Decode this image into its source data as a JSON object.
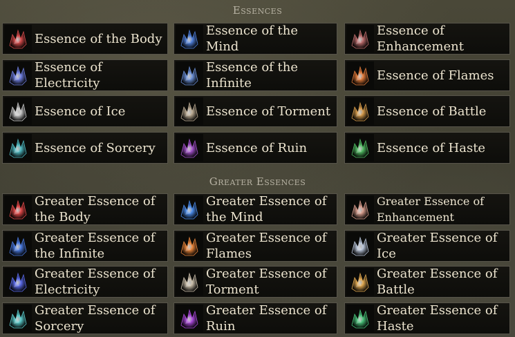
{
  "sections": [
    {
      "title": "Essences",
      "items": [
        {
          "label": "Essence of the Body",
          "icon": "body-essence-icon",
          "color": "#d24a4a"
        },
        {
          "label": "Essence of the Mind",
          "icon": "mind-essence-icon",
          "color": "#4f7fd9"
        },
        {
          "label": "Essence of Enhancement",
          "icon": "enhancement-essence-icon",
          "color": "#b86a6a"
        },
        {
          "label": "Essence of Electricity",
          "icon": "electricity-essence-icon",
          "color": "#6f7fe0"
        },
        {
          "label": "Essence of the Infinite",
          "icon": "infinite-essence-icon",
          "color": "#6a8fd6"
        },
        {
          "label": "Essence of Flames",
          "icon": "flames-essence-icon",
          "color": "#e07a3a"
        },
        {
          "label": "Essence of Ice",
          "icon": "ice-essence-icon",
          "color": "#c9c9c9"
        },
        {
          "label": "Essence of Torment",
          "icon": "torment-essence-icon",
          "color": "#b8a890"
        },
        {
          "label": "Essence of Battle",
          "icon": "battle-essence-icon",
          "color": "#d49a4a"
        },
        {
          "label": "Essence of Sorcery",
          "icon": "sorcery-essence-icon",
          "color": "#4fb8c0"
        },
        {
          "label": "Essence of Ruin",
          "icon": "ruin-essence-icon",
          "color": "#a050c8"
        },
        {
          "label": "Essence of Haste",
          "icon": "haste-essence-icon",
          "color": "#4fb860"
        }
      ]
    },
    {
      "title": "Greater Essences",
      "items": [
        {
          "label": "Greater Essence of the Body",
          "icon": "greater-body-essence-icon",
          "color": "#e04848"
        },
        {
          "label": "Greater Essence of the Mind",
          "icon": "greater-mind-essence-icon",
          "color": "#4a8ae8"
        },
        {
          "label": "Greater Essence of Enhancement",
          "icon": "greater-enhancement-essence-icon",
          "color": "#d49a8a",
          "small": true
        },
        {
          "label": "Greater Essence of the Infinite",
          "icon": "greater-infinite-essence-icon",
          "color": "#4a7ae0"
        },
        {
          "label": "Greater Essence of Flames",
          "icon": "greater-flames-essence-icon",
          "color": "#e8843a"
        },
        {
          "label": "Greater Essence of Ice",
          "icon": "greater-ice-essence-icon",
          "color": "#b8c4d8"
        },
        {
          "label": "Greater Essence of Electricity",
          "icon": "greater-electricity-essence-icon",
          "color": "#5a6ae8"
        },
        {
          "label": "Greater Essence of Torment",
          "icon": "greater-torment-essence-icon",
          "color": "#c8bca8"
        },
        {
          "label": "Greater Essence of Battle",
          "icon": "greater-battle-essence-icon",
          "color": "#e0a850"
        },
        {
          "label": "Greater Essence of Sorcery",
          "icon": "greater-sorcery-essence-icon",
          "color": "#5ac8c8"
        },
        {
          "label": "Greater Essence of Ruin",
          "icon": "greater-ruin-essence-icon",
          "color": "#a848d8"
        },
        {
          "label": "Greater Essence of Haste",
          "icon": "greater-haste-essence-icon",
          "color": "#48c078"
        }
      ]
    }
  ]
}
